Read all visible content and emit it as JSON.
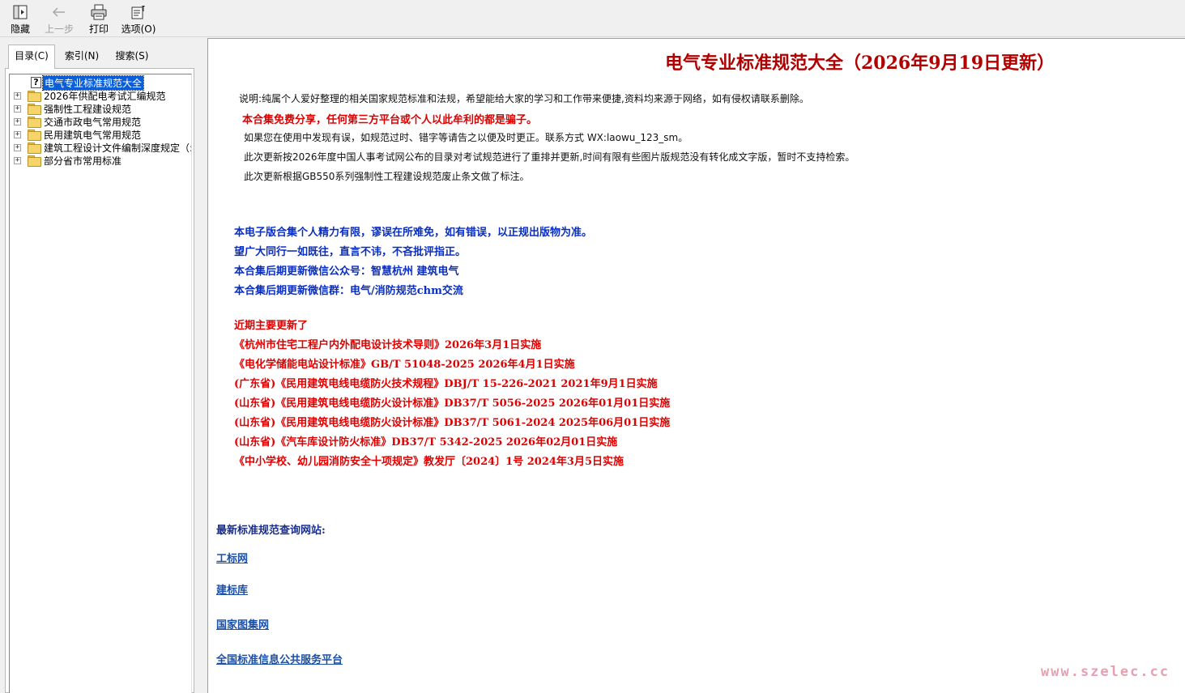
{
  "toolbar": {
    "hide_label": "隐藏",
    "back_label": "上一步",
    "print_label": "打印",
    "options_label": "选项(O)"
  },
  "tabs": {
    "toc": "目录(C)",
    "index": "索引(N)",
    "search": "搜索(S)"
  },
  "tree": {
    "root": "电气专业标准规范大全",
    "items": [
      "2026年供配电考试汇编规范",
      "强制性工程建设规范",
      "交通市政电气常用规范",
      "民用建筑电气常用规范",
      "建筑工程设计文件编制深度规定（:",
      "部分省市常用标准"
    ]
  },
  "content": {
    "title": "电气专业标准规范大全（2026年9月19日更新）",
    "notes": [
      "说明:纯属个人爱好整理的相关国家规范标准和法规，希望能给大家的学习和工作带来便捷,资料均来源于网络，如有侵权请联系删除。",
      "本合集免费分享，任何第三方平台或个人以此牟利的都是骗子。",
      "如果您在使用中发现有误，如规范过时、错字等请告之以便及时更正。联系方式 WX:laowu_123_sm。",
      "此次更新按2026年度中国人事考试网公布的目录对考试规范进行了重排并更新,时间有限有些图片版规范没有转化成文字版，暂时不支持检索。",
      "此次更新根据GB550系列强制性工程建设规范废止条文做了标注。"
    ],
    "blue_lines": [
      "本电子版合集个人精力有限，谬误在所难免，如有错误，以正规出版物为准。",
      "望广大同行一如既往，直言不讳，不吝批评指正。",
      "本合集后期更新微信公众号：智慧杭州 建筑电气",
      "本合集后期更新微信群：电气/消防规范chm交流"
    ],
    "updates_heading": "近期主要更新了",
    "updates": [
      "《杭州市住宅工程户内外配电设计技术导则》2026年3月1日实施",
      "《电化学储能电站设计标准》GB/T 51048-2025 2026年4月1日实施",
      "(广东省)《民用建筑电线电缆防火技术规程》DBJ/T 15-226-2021 2021年9月1日实施",
      "(山东省)《民用建筑电线电缆防火设计标准》DB37/T 5056-2025 2026年01月01日实施",
      "(山东省)《民用建筑电线电缆防火设计标准》DB37/T 5061-2024 2025年06月01日实施",
      "(山东省)《汽车库设计防火标准》DB37/T 5342-2025 2026年02月01日实施",
      "《中小学校、幼儿园消防安全十项规定》教发厅〔2024〕1号 2024年3月5日实施"
    ],
    "links_heading": "最新标准规范查询网站:",
    "links": [
      "工标网",
      "建标库",
      "国家图集网",
      "全国标准信息公共服务平台"
    ]
  },
  "watermark": "www.szelec.cc",
  "colors": {
    "title": "#b00000",
    "red_text": "#e00000",
    "blue_text": "#0a2fc0",
    "link": "#1a4fa8",
    "selection": "#0a5ed8"
  }
}
